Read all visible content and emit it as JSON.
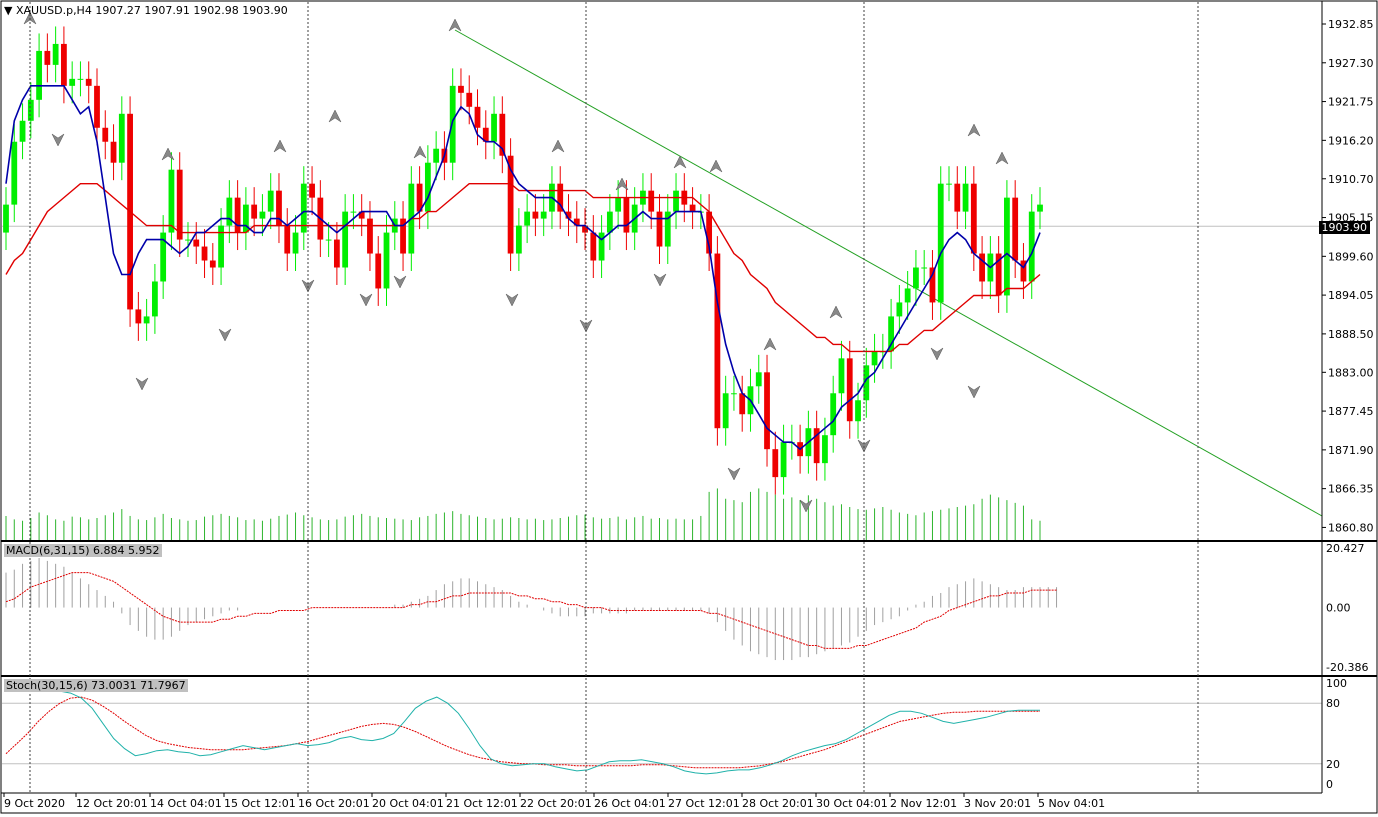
{
  "header": {
    "symbol": "XAUUSD.p,H4",
    "ohlc": "1907.27 1907.91 1902.98 1903.90"
  },
  "macd": {
    "label": "MACD(6,31,15) 6.884 5.952",
    "scale": [
      "20.427",
      "0.00",
      "-20.386"
    ]
  },
  "stoch": {
    "label": "Stoch(30,15,6) 73.0031 71.7967",
    "scale": [
      "100",
      "80",
      "20",
      "0"
    ]
  },
  "current_price": "1903.90",
  "chart_data": [
    {
      "type": "candlestick",
      "title": "XAUUSD.p,H4",
      "y_ticks": [
        "1932.85",
        "1927.30",
        "1921.75",
        "1916.20",
        "1910.70",
        "1905.15",
        "1899.60",
        "1894.05",
        "1888.50",
        "1883.00",
        "1877.45",
        "1871.90",
        "1866.35",
        "1860.80"
      ],
      "x_ticks": [
        "9 Oct 2020",
        "12 Oct 20:01",
        "14 Oct 04:01",
        "15 Oct 12:01",
        "16 Oct 20:01",
        "20 Oct 04:01",
        "21 Oct 12:01",
        "22 Oct 20:01",
        "26 Oct 04:01",
        "27 Oct 12:01",
        "28 Oct 20:01",
        "30 Oct 04:01",
        "2 Nov 12:01",
        "3 Nov 20:01",
        "5 Nov 04:01"
      ],
      "ylim": [
        1859.0,
        1936.0
      ],
      "close": [
        1907,
        1916,
        1919,
        1922,
        1929,
        1927,
        1930,
        1924,
        1925,
        1925,
        1924,
        1918,
        1916,
        1913,
        1920,
        1892,
        1890,
        1891,
        1896,
        1903,
        1912,
        1902,
        1902,
        1901,
        1899,
        1898,
        1904,
        1908,
        1903,
        1907,
        1905,
        1906,
        1909,
        1904,
        1900,
        1903,
        1910,
        1908,
        1902,
        1902,
        1898,
        1906,
        1906,
        1905,
        1900,
        1895,
        1903,
        1905,
        1900,
        1910,
        1906,
        1913,
        1915,
        1913,
        1924,
        1923,
        1921,
        1918,
        1916,
        1920,
        1914,
        1900,
        1904,
        1906,
        1905,
        1906,
        1910,
        1906,
        1905,
        1904,
        1903,
        1899,
        1903,
        1906,
        1908,
        1903,
        1907,
        1909,
        1906,
        1901,
        1906,
        1909,
        1907,
        1906,
        1906,
        1900,
        1875,
        1880,
        1880,
        1877,
        1881,
        1883,
        1872,
        1868,
        1873,
        1873,
        1871,
        1875,
        1870,
        1874,
        1880,
        1885,
        1876,
        1879,
        1884,
        1886,
        1886,
        1891,
        1893,
        1895,
        1898,
        1898,
        1893,
        1910,
        1910,
        1906,
        1910,
        1900,
        1896,
        1900,
        1894,
        1908,
        1899,
        1896,
        1906,
        1907
      ],
      "ma_fast": [
        1910,
        1919,
        1922,
        1924,
        1924,
        1924,
        1924,
        1924,
        1922,
        1920,
        1921,
        1916,
        1908,
        1900,
        1897,
        1897,
        1900,
        1902,
        1902,
        1902,
        1901,
        1900,
        1901,
        1903,
        1903,
        1904,
        1905,
        1905,
        1904,
        1904,
        1903,
        1903,
        1905,
        1905,
        1904,
        1905,
        1906,
        1906,
        1905,
        1904,
        1903,
        1904,
        1905,
        1906,
        1906,
        1906,
        1906,
        1904,
        1904,
        1905,
        1906,
        1908,
        1911,
        1914,
        1919,
        1921,
        1920,
        1917,
        1916,
        1916,
        1915,
        1912,
        1910,
        1909,
        1908,
        1908,
        1908,
        1907,
        1905,
        1904,
        1904,
        1903,
        1902,
        1903,
        1904,
        1904,
        1905,
        1906,
        1905,
        1905,
        1905,
        1906,
        1906,
        1906,
        1906,
        1901,
        1893,
        1887,
        1883,
        1880,
        1879,
        1877,
        1875,
        1874,
        1873,
        1873,
        1872,
        1873,
        1874,
        1875,
        1876,
        1878,
        1879,
        1880,
        1882,
        1883,
        1885,
        1887,
        1889,
        1891,
        1893,
        1895,
        1897,
        1900,
        1902,
        1903,
        1902,
        1900,
        1899,
        1898,
        1899,
        1900,
        1899,
        1898,
        1900,
        1903
      ],
      "ma_slow": [
        1897,
        1899,
        1900,
        1902,
        1904,
        1906,
        1907,
        1908,
        1909,
        1910,
        1910,
        1910,
        1909,
        1908,
        1907,
        1906,
        1905,
        1904,
        1904,
        1904,
        1904,
        1903,
        1903,
        1903,
        1903,
        1903,
        1903,
        1903,
        1903,
        1903,
        1904,
        1904,
        1904,
        1904,
        1904,
        1904,
        1904,
        1904,
        1904,
        1904,
        1904,
        1904,
        1904,
        1904,
        1904,
        1904,
        1904,
        1904,
        1904,
        1905,
        1905,
        1906,
        1906,
        1907,
        1908,
        1909,
        1910,
        1910,
        1910,
        1910,
        1910,
        1910,
        1909,
        1909,
        1909,
        1909,
        1909,
        1909,
        1909,
        1909,
        1909,
        1908,
        1908,
        1908,
        1908,
        1908,
        1908,
        1908,
        1908,
        1908,
        1908,
        1908,
        1908,
        1908,
        1907,
        1906,
        1904,
        1902,
        1900,
        1899,
        1897,
        1896,
        1895,
        1893,
        1892,
        1891,
        1890,
        1889,
        1888,
        1888,
        1887,
        1887,
        1886,
        1886,
        1886,
        1886,
        1886,
        1886,
        1887,
        1887,
        1888,
        1889,
        1889,
        1890,
        1891,
        1892,
        1893,
        1894,
        1894,
        1894,
        1894,
        1895,
        1895,
        1895,
        1896,
        1897
      ],
      "volume": [
        35,
        30,
        28,
        32,
        40,
        36,
        30,
        28,
        34,
        33,
        30,
        32,
        36,
        40,
        45,
        35,
        30,
        29,
        33,
        38,
        32,
        30,
        28,
        29,
        34,
        36,
        38,
        35,
        33,
        29,
        30,
        28,
        31,
        35,
        37,
        40,
        36,
        33,
        30,
        29,
        30,
        34,
        36,
        38,
        35,
        33,
        32,
        31,
        30,
        29,
        33,
        35,
        38,
        40,
        42,
        38,
        36,
        34,
        32,
        30,
        31,
        33,
        32,
        30,
        31,
        29,
        30,
        32,
        34,
        36,
        37,
        33,
        31,
        32,
        34,
        30,
        33,
        35,
        31,
        32,
        30,
        31,
        30,
        30,
        35,
        70,
        75,
        60,
        58,
        55,
        70,
        75,
        70,
        66,
        60,
        62,
        58,
        65,
        60,
        55,
        50,
        52,
        48,
        45,
        44,
        46,
        48,
        44,
        40,
        38,
        36,
        40,
        42,
        44,
        46,
        48,
        50,
        52,
        60,
        66,
        62,
        58,
        54,
        50,
        30,
        28
      ]
    },
    {
      "type": "bar",
      "title": "MACD(6,31,15)",
      "ylim": [
        -20.386,
        20.427
      ],
      "values": [
        12,
        13,
        15,
        16,
        17,
        16,
        15,
        14,
        12,
        10,
        8,
        6,
        4,
        2,
        -2,
        -6,
        -8,
        -10,
        -11,
        -11,
        -10,
        -8,
        -6,
        -5,
        -4,
        -3,
        -2,
        -1,
        -1,
        0,
        0,
        0,
        0,
        0,
        0,
        0,
        0,
        0,
        0,
        0,
        0,
        0,
        0,
        0,
        0,
        0,
        0,
        1,
        1,
        2,
        3,
        4,
        6,
        8,
        9,
        10,
        10,
        9,
        8,
        7,
        6,
        4,
        2,
        1,
        0,
        -1,
        -2,
        -3,
        -3,
        -3,
        -3,
        -2,
        -2,
        -2,
        -2,
        -2,
        -1,
        -1,
        -1,
        -1,
        -1,
        -1,
        -1,
        -1,
        -1,
        -2,
        -5,
        -8,
        -11,
        -13,
        -15,
        -16,
        -17,
        -18,
        -18,
        -18,
        -17,
        -17,
        -16,
        -15,
        -14,
        -13,
        -12,
        -10,
        -8,
        -6,
        -5,
        -4,
        -3,
        -1,
        1,
        2,
        4,
        5,
        7,
        8,
        9,
        10,
        9,
        8,
        7,
        6,
        6,
        7,
        7,
        7,
        7,
        7
      ],
      "signal": [
        2,
        3,
        5,
        7,
        8,
        9,
        10,
        11,
        12,
        12,
        12,
        11,
        10,
        9,
        7,
        5,
        3,
        1,
        -1,
        -3,
        -4,
        -5,
        -5,
        -5,
        -5,
        -5,
        -4,
        -4,
        -3,
        -3,
        -2,
        -2,
        -2,
        -1,
        -1,
        -1,
        -1,
        0,
        0,
        0,
        0,
        0,
        0,
        0,
        0,
        0,
        0,
        0,
        0,
        1,
        1,
        2,
        2,
        3,
        4,
        4,
        5,
        5,
        5,
        5,
        5,
        5,
        4,
        4,
        3,
        3,
        2,
        2,
        1,
        1,
        0,
        0,
        0,
        -1,
        -1,
        -1,
        -1,
        -1,
        -1,
        -1,
        -1,
        -1,
        -1,
        -1,
        -1,
        -2,
        -2,
        -3,
        -4,
        -5,
        -6,
        -7,
        -8,
        -9,
        -10,
        -11,
        -12,
        -13,
        -13,
        -14,
        -14,
        -14,
        -14,
        -13,
        -13,
        -12,
        -11,
        -10,
        -9,
        -8,
        -7,
        -5,
        -4,
        -3,
        -1,
        0,
        1,
        2,
        3,
        4,
        4,
        5,
        5,
        5,
        6,
        6,
        6,
        6
      ]
    },
    {
      "type": "line",
      "title": "Stoch(30,15,6)",
      "ylim": [
        0,
        100
      ],
      "main": [
        95,
        100,
        100,
        98,
        95,
        92,
        90,
        85,
        75,
        60,
        45,
        35,
        28,
        30,
        33,
        34,
        32,
        31,
        28,
        29,
        32,
        35,
        38,
        36,
        34,
        36,
        38,
        40,
        38,
        39,
        41,
        45,
        47,
        44,
        43,
        45,
        50,
        62,
        75,
        82,
        86,
        80,
        70,
        55,
        38,
        25,
        20,
        18,
        19,
        20,
        20,
        17,
        15,
        13,
        14,
        18,
        22,
        23,
        23,
        24,
        22,
        20,
        17,
        13,
        11,
        10,
        11,
        13,
        14,
        14,
        16,
        19,
        23,
        28,
        32,
        35,
        38,
        40,
        44,
        50,
        56,
        62,
        68,
        72,
        72,
        70,
        66,
        62,
        60,
        62,
        64,
        66,
        69,
        72,
        73,
        73,
        73
      ],
      "signal": [
        30,
        40,
        50,
        62,
        72,
        80,
        85,
        86,
        83,
        77,
        70,
        62,
        55,
        48,
        43,
        40,
        38,
        36,
        35,
        34,
        34,
        34,
        34,
        35,
        36,
        37,
        38,
        40,
        42,
        45,
        48,
        51,
        54,
        57,
        59,
        60,
        59,
        56,
        52,
        47,
        42,
        37,
        33,
        29,
        26,
        24,
        22,
        21,
        20,
        20,
        19,
        19,
        19,
        18,
        18,
        18,
        18,
        18,
        18,
        19,
        19,
        19,
        18,
        17,
        16,
        16,
        16,
        16,
        16,
        17,
        18,
        20,
        22,
        25,
        28,
        31,
        34,
        38,
        42,
        46,
        50,
        54,
        58,
        62,
        64,
        66,
        68,
        70,
        71,
        71,
        72,
        72,
        72,
        72,
        72,
        72,
        72
      ]
    }
  ]
}
